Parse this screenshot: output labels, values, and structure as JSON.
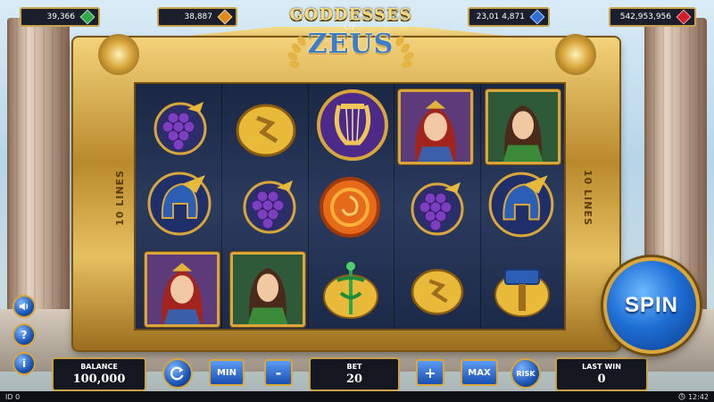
{
  "top_bars": [
    {
      "value": "39,366",
      "gem_color": "#2fa84a"
    },
    {
      "value": "38,887",
      "gem_color": "#e08a1c"
    },
    {
      "value": "23,01 4,871",
      "gem_color": "#2b6fd6"
    },
    {
      "value": "542,953,956",
      "gem_color": "#d11c2a"
    }
  ],
  "logo": {
    "line1": "GODDESSES",
    "line2": "OF",
    "line3": "ZEUS"
  },
  "lines_label": "10 LINES",
  "reels": [
    [
      "grapes",
      "helmet",
      "goddess-red"
    ],
    [
      "coin",
      "grapes",
      "goddess-green"
    ],
    [
      "lyre",
      "shield-sun",
      "caduceus"
    ],
    [
      "goddess-red",
      "grapes",
      "coin"
    ],
    [
      "goddess-green",
      "helmet",
      "hammer"
    ]
  ],
  "side_buttons": {
    "sound": "sound-icon",
    "help": "?",
    "info": "i"
  },
  "bottom": {
    "balance_label": "BALANCE",
    "balance_value": "100,000",
    "min_label": "MIN",
    "minus_label": "-",
    "bet_label": "BET",
    "bet_value": "20",
    "plus_label": "+",
    "max_label": "MAX",
    "risk_label": "RISK",
    "lastwin_label": "LAST WIN",
    "lastwin_value": "0"
  },
  "spin_label": "SPIN",
  "status": {
    "id_label": "ID 0",
    "time": "12:42"
  },
  "colors": {
    "gold": "#d9a63b",
    "blue_button": "#1c56b5"
  }
}
